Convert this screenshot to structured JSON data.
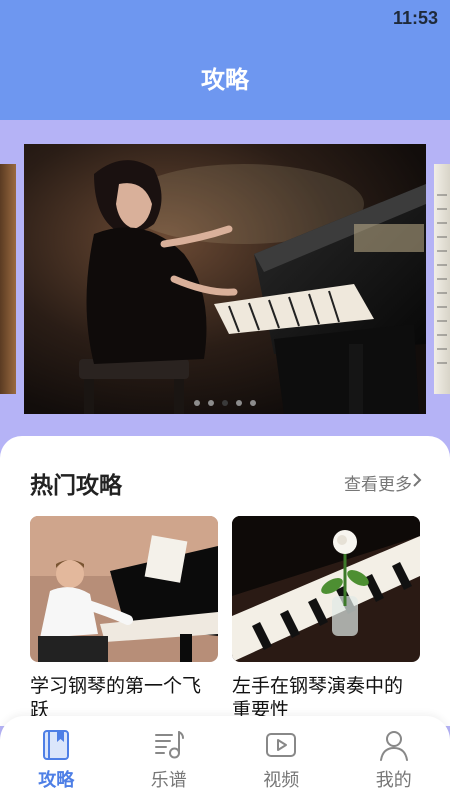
{
  "status": {
    "time": "11:53"
  },
  "header": {
    "title": "攻略"
  },
  "banner": {
    "dot_count": 5,
    "active_dot": 2
  },
  "hot": {
    "title": "热门攻略",
    "more_label": "查看更多",
    "articles": [
      {
        "title": "学习钢琴的第一个飞跃"
      },
      {
        "title": "左手在钢琴演奏中的重要性"
      }
    ]
  },
  "nav": {
    "items": [
      {
        "label": "攻略",
        "icon": "book-icon",
        "active": true
      },
      {
        "label": "乐谱",
        "icon": "music-score-icon",
        "active": false
      },
      {
        "label": "视频",
        "icon": "video-icon",
        "active": false
      },
      {
        "label": "我的",
        "icon": "profile-icon",
        "active": false
      }
    ]
  },
  "colors": {
    "primary": "#6e97f0",
    "background": "#b5b3f6",
    "active_tab": "#4e7fe6"
  }
}
